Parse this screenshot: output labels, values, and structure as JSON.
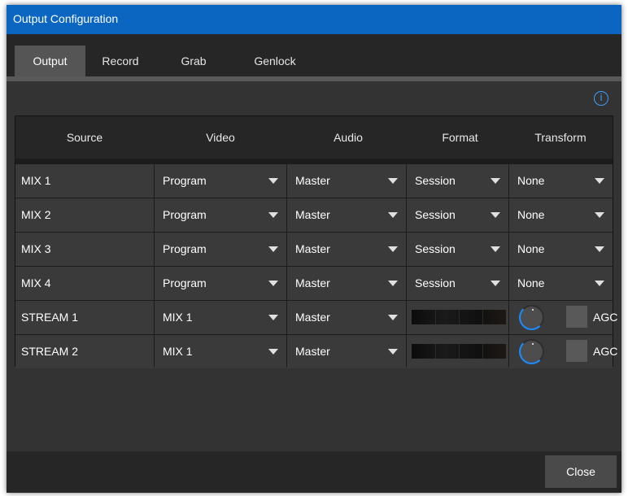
{
  "window": {
    "title": "Output Configuration"
  },
  "tabs": [
    {
      "label": "Output",
      "active": true
    },
    {
      "label": "Record",
      "active": false
    },
    {
      "label": "Grab",
      "active": false
    },
    {
      "label": "Genlock",
      "active": false
    }
  ],
  "info_icon": {
    "glyph": "i",
    "icon": "info-icon"
  },
  "table": {
    "headers": [
      "Source",
      "Video",
      "Audio",
      "Format",
      "Transform"
    ],
    "rows": [
      {
        "source": "MIX 1",
        "video": "Program",
        "audio": "Master",
        "format": "Session",
        "transform": "None"
      },
      {
        "source": "MIX 2",
        "video": "Program",
        "audio": "Master",
        "format": "Session",
        "transform": "None"
      },
      {
        "source": "MIX 3",
        "video": "Program",
        "audio": "Master",
        "format": "Session",
        "transform": "None"
      },
      {
        "source": "MIX 4",
        "video": "Program",
        "audio": "Master",
        "format": "Session",
        "transform": "None"
      },
      {
        "source": "STREAM 1",
        "video": "MIX 1",
        "audio": "Master",
        "agc_label": "AGC"
      },
      {
        "source": "STREAM 2",
        "video": "MIX 1",
        "audio": "Master",
        "agc_label": "AGC"
      }
    ]
  },
  "footer": {
    "close_label": "Close"
  },
  "colors": {
    "title_bar": "#0a66c0",
    "window_bg": "#333333",
    "accent": "#1a8cff"
  }
}
